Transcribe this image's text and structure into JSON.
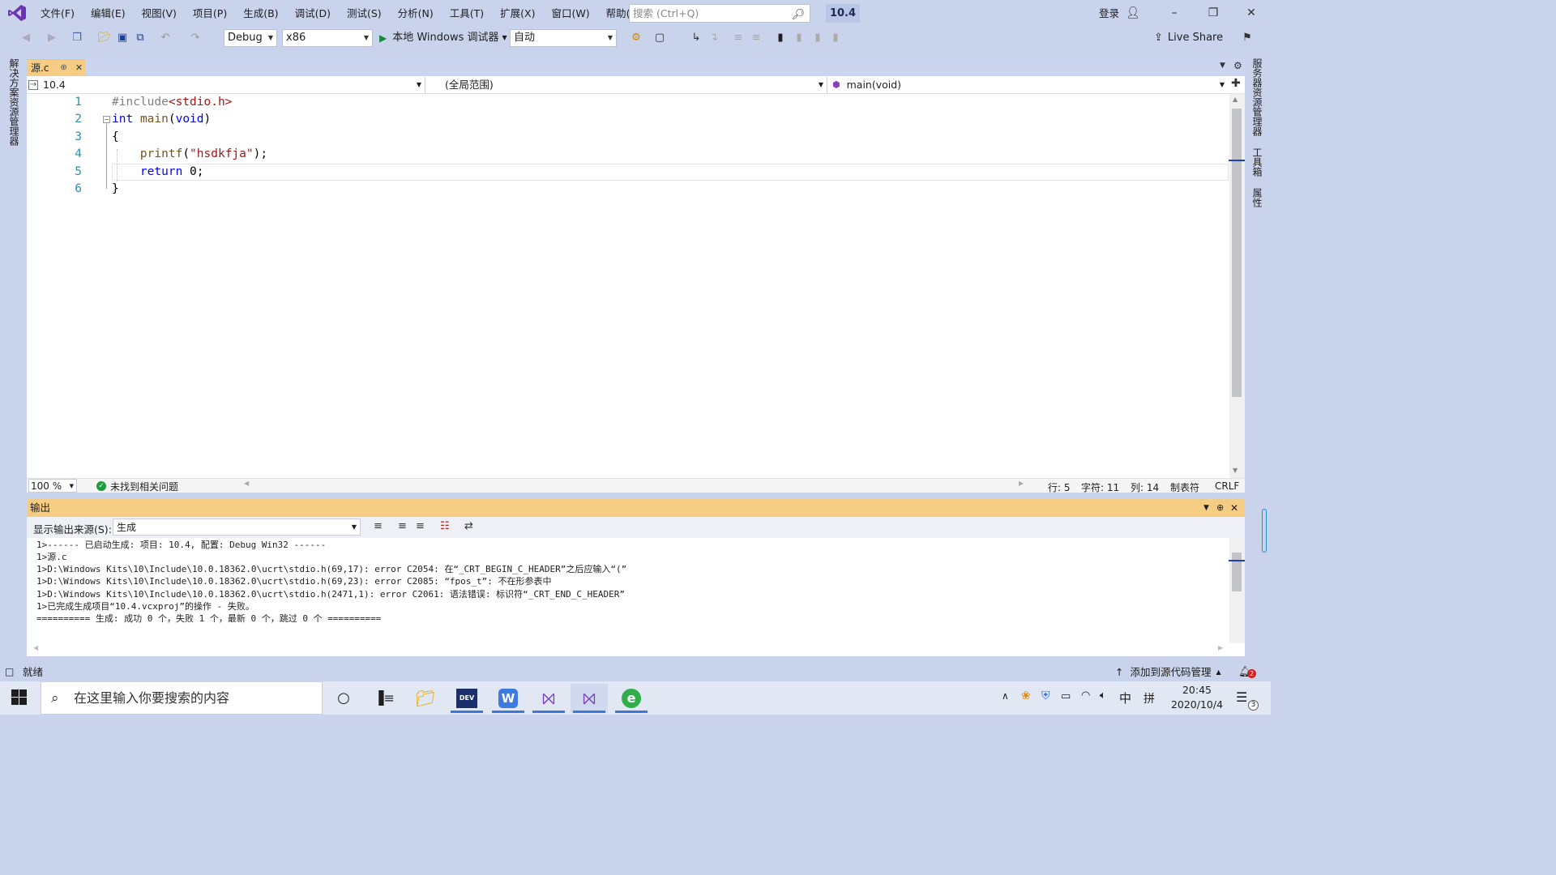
{
  "menubar": {
    "items": [
      "文件(F)",
      "编辑(E)",
      "视图(V)",
      "项目(P)",
      "生成(B)",
      "调试(D)",
      "测试(S)",
      "分析(N)",
      "工具(T)",
      "扩展(X)",
      "窗口(W)",
      "帮助(H)"
    ],
    "search_placeholder": "搜索 (Ctrl+Q)",
    "solution_name": "10.4",
    "login": "登录"
  },
  "toolbar": {
    "config": "Debug",
    "platform": "x86",
    "run_label": "本地 Windows 调试器",
    "run_mode": "自动",
    "live_share": "Live Share"
  },
  "sidebars": {
    "left": "解决方案资源管理器",
    "right": [
      "服务器资源管理器",
      "工具箱",
      "属性"
    ]
  },
  "editor": {
    "tab_name": "源.c",
    "nav_project": "10.4",
    "nav_scope": "(全局范围)",
    "nav_member": "main(void)",
    "line_numbers": [
      "1",
      "2",
      "3",
      "4",
      "5",
      "6"
    ],
    "zoom": "100 %",
    "issues": "未找到相关问题",
    "status_line": "行: 5",
    "status_char": "字符: 11",
    "status_col": "列: 14",
    "status_tabs": "制表符",
    "status_eol": "CRLF"
  },
  "code": {
    "l1_pp": "#include",
    "l1_inc": "<stdio.h>",
    "l2_kw": "int",
    "l2_fn": "main",
    "l2_open": "(",
    "l2_void": "void",
    "l2_close": ")",
    "l3": "{",
    "l4_fn": "printf",
    "l4_open": "(",
    "l4_str": "\"hsdkfja\"",
    "l4_close": ");",
    "l5_kw": "return",
    "l5_rest": " 0;",
    "l6": "}"
  },
  "output": {
    "title": "输出",
    "source_label": "显示输出来源(S):",
    "source_value": "生成",
    "lines": [
      "1>------ 已启动生成: 项目: 10.4, 配置: Debug Win32 ------",
      "1>源.c",
      "1>D:\\Windows Kits\\10\\Include\\10.0.18362.0\\ucrt\\stdio.h(69,17): error C2054: 在“_CRT_BEGIN_C_HEADER”之后应输入“(”",
      "1>D:\\Windows Kits\\10\\Include\\10.0.18362.0\\ucrt\\stdio.h(69,23): error C2085: “fpos_t”: 不在形参表中",
      "1>D:\\Windows Kits\\10\\Include\\10.0.18362.0\\ucrt\\stdio.h(2471,1): error C2061: 语法错误: 标识符“_CRT_END_C_HEADER”",
      "1>已完成生成项目“10.4.vcxproj”的操作 - 失败。",
      "========== 生成: 成功 0 个，失败 1 个，最新 0 个，跳过 0 个 =========="
    ]
  },
  "statusbar": {
    "ready": "就绪",
    "source_control": "添加到源代码管理",
    "notifications": "2"
  },
  "taskbar": {
    "search_placeholder": "在这里输入你要搜索的内容",
    "time": "20:45",
    "date": "2020/10/4",
    "ime_lang": "中",
    "ime_mode": "拼",
    "notif_count": "3"
  },
  "colors": {
    "chrome": "#cad3ec",
    "active_tab": "#f5cc84",
    "keyword": "#0000ff",
    "string": "#a31515"
  }
}
